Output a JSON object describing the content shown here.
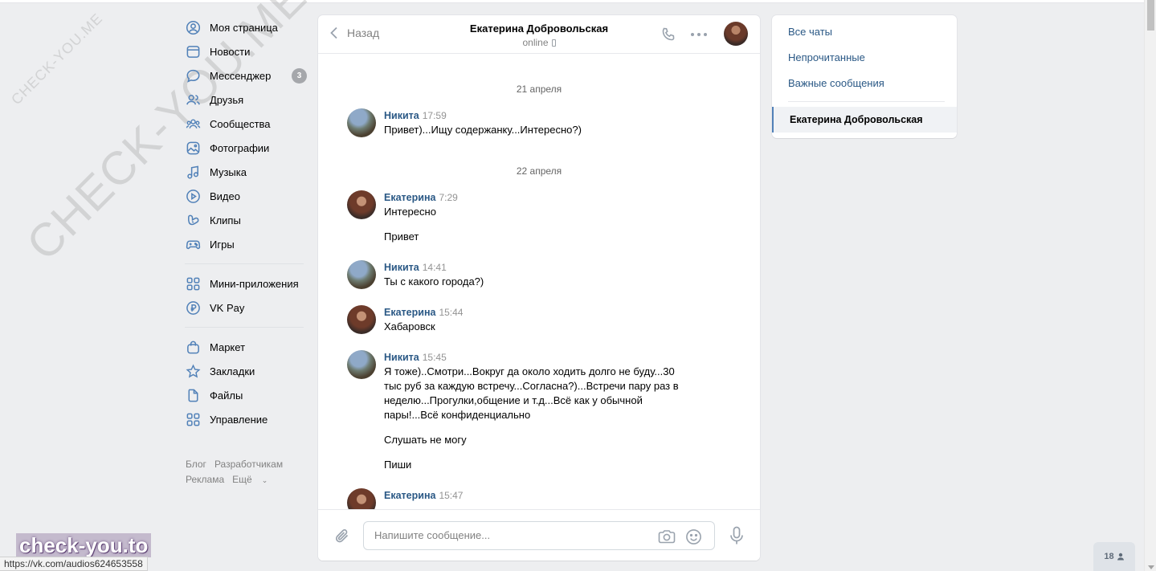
{
  "watermark": {
    "small": "CHECK-YOU.ME",
    "large": "CHECK-YOU.ME"
  },
  "sidebar": {
    "items": [
      {
        "label": "Моя страница",
        "icon": "user-circle-icon"
      },
      {
        "label": "Новости",
        "icon": "news-icon"
      },
      {
        "label": "Мессенджер",
        "icon": "chat-bubble-icon",
        "badge": "3"
      },
      {
        "label": "Друзья",
        "icon": "friends-icon"
      },
      {
        "label": "Сообщества",
        "icon": "communities-icon"
      },
      {
        "label": "Фотографии",
        "icon": "photo-icon"
      },
      {
        "label": "Музыка",
        "icon": "music-note-icon"
      },
      {
        "label": "Видео",
        "icon": "play-circle-icon"
      },
      {
        "label": "Клипы",
        "icon": "clips-icon"
      },
      {
        "label": "Игры",
        "icon": "gamepad-icon"
      }
    ],
    "items2": [
      {
        "label": "Мини-приложения",
        "icon": "grid-icon"
      },
      {
        "label": "VK Pay",
        "icon": "ruble-circle-icon"
      }
    ],
    "items3": [
      {
        "label": "Маркет",
        "icon": "bag-icon"
      },
      {
        "label": "Закладки",
        "icon": "star-icon"
      },
      {
        "label": "Файлы",
        "icon": "file-icon"
      },
      {
        "label": "Управление",
        "icon": "grid-icon"
      }
    ],
    "footer": {
      "blog": "Блог",
      "developers": "Разработчикам",
      "ads": "Реклама",
      "more": "Ещё"
    }
  },
  "chat": {
    "back_label": "Назад",
    "peer_name": "Екатерина Добровольская",
    "peer_status": "online",
    "composer_placeholder": "Напишите сообщение...",
    "dates": [
      "21 апреля",
      "22 апреля"
    ],
    "messages": [
      {
        "author": "Никита",
        "time": "17:59",
        "texts": [
          "Привет)...Ищу содержанку...Интересно?)"
        ]
      },
      {
        "author": "Екатерина",
        "time": "7:29",
        "texts": [
          "Интересно",
          "Привет"
        ]
      },
      {
        "author": "Никита",
        "time": "14:41",
        "texts": [
          "Ты с какого города?)"
        ]
      },
      {
        "author": "Екатерина",
        "time": "15:44",
        "texts": [
          "Хабаровск"
        ]
      },
      {
        "author": "Никита",
        "time": "15:45",
        "texts": [
          "Я тоже)..Смотри...Вокруг да около ходить долго не буду...30 тыс руб за каждую встречу...Согласна?)...Встречи пару раз в неделю...Прогулки,общение и т.д...Всё как у обычной пары!...Всё конфиденциально",
          "Слушать не могу",
          "Пиши"
        ]
      },
      {
        "author": "Екатерина",
        "time": "15:47",
        "texts": []
      }
    ]
  },
  "right_panel": {
    "all_chats": "Все чаты",
    "unread": "Непрочитанные",
    "important": "Важные сообщения",
    "active_chat": "Екатерина Добровольская"
  },
  "overlay": {
    "brand": "check-you.to",
    "status_url": "https://vk.com/audios624653558",
    "online_count": "18"
  },
  "colors": {
    "background": "#edeef0",
    "link": "#2a5885",
    "accent": "#5181b8",
    "muted": "#828282"
  }
}
